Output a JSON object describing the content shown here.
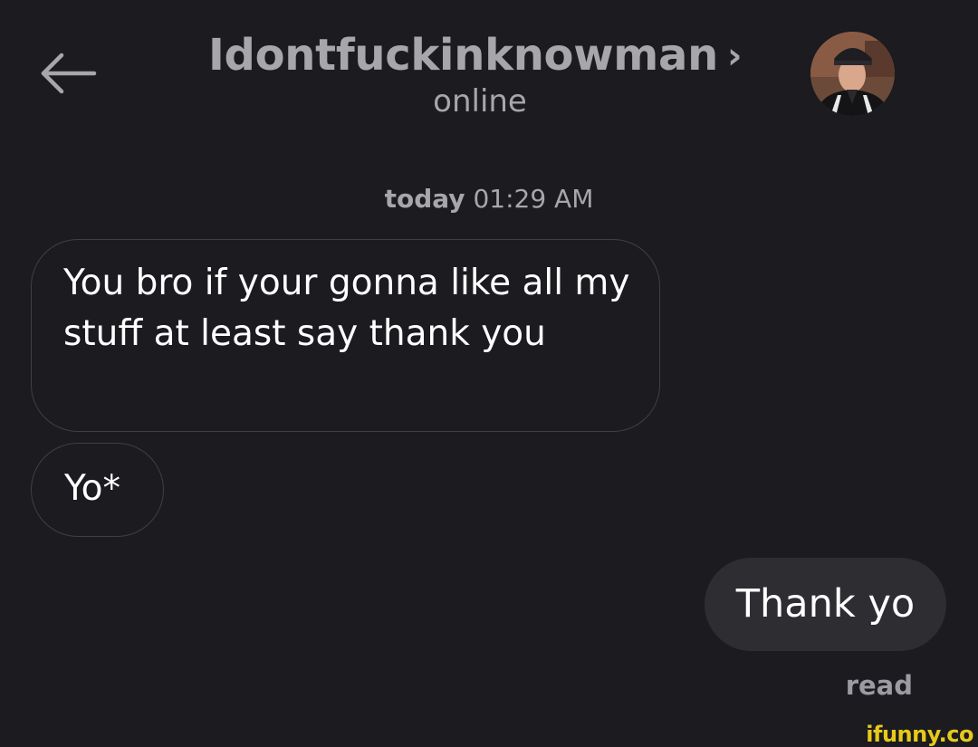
{
  "header": {
    "back_icon": "arrow-left-icon",
    "username": "Idontfuckinknowman",
    "chevron": "›",
    "status": "online",
    "avatar": "profile-photo"
  },
  "conversation": {
    "timestamp_day": "today",
    "timestamp_time": "01:29 AM",
    "messages": [
      {
        "direction": "incoming",
        "text": "You bro if your gonna like all my stuff at least say thank you"
      },
      {
        "direction": "incoming",
        "text": "Yo*"
      },
      {
        "direction": "outgoing",
        "text": "Thank yo"
      }
    ],
    "read_receipt": "read"
  },
  "watermark": "ifunny.co",
  "colors": {
    "background": "#1b1b20",
    "header_text": "#a6a6ab",
    "incoming_border": "#3f3f46",
    "outgoing_bubble": "#2d2d32",
    "watermark": "#e7c91a"
  }
}
